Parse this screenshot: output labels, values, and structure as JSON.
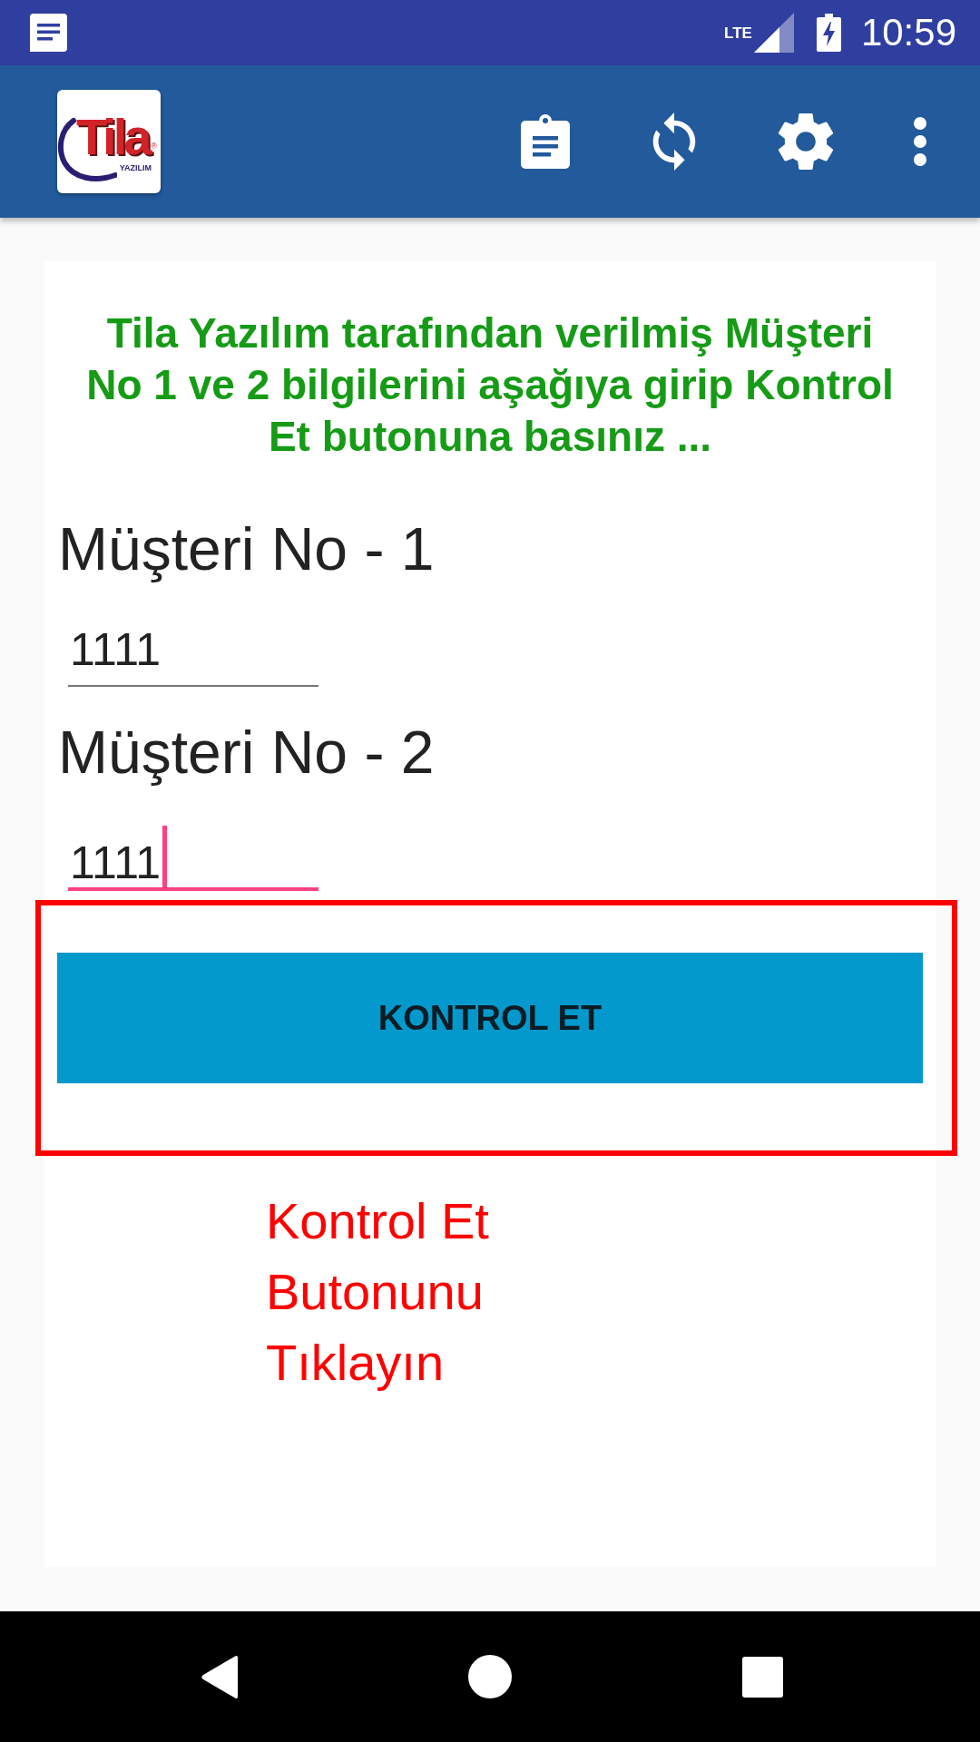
{
  "status_bar": {
    "network": "LTE",
    "time": "10:59"
  },
  "app_bar": {
    "logo": {
      "name": "Tila",
      "mark": "®",
      "tagline": "YAZILIM"
    },
    "actions": [
      {
        "kind": "clipboard"
      },
      {
        "kind": "sync"
      },
      {
        "kind": "settings"
      },
      {
        "kind": "more"
      }
    ]
  },
  "instructions": "Tila Yazılım tarafından verilmiş Müşteri No 1 ve 2 bilgilerini aşağıya girip Kontrol Et butonuna basınız ...",
  "fields": [
    {
      "label": "Müşteri No - 1",
      "value": "1111",
      "focused": false
    },
    {
      "label": "Müşteri No - 2",
      "value": "1111",
      "focused": true
    }
  ],
  "button": {
    "label": "KONTROL ET"
  },
  "annotation": {
    "text": "Kontrol Et Butonunu Tıklayın"
  },
  "nav_bar": {
    "buttons": [
      {
        "kind": "back"
      },
      {
        "kind": "home"
      },
      {
        "kind": "recents"
      }
    ]
  }
}
